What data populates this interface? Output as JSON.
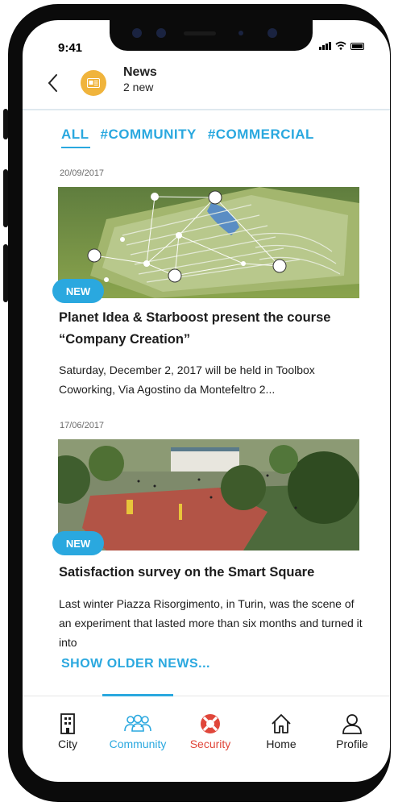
{
  "status": {
    "time": "9:41"
  },
  "header": {
    "title": "News",
    "subtitle": "2 new"
  },
  "tabs": [
    "ALL",
    "#COMMUNITY",
    "#COMMERCIAL"
  ],
  "news": [
    {
      "date": "20/09/2017",
      "badge": "NEW",
      "title": "Planet Idea & Starboost present the course “Company Creation”",
      "body": "Saturday, December 2, 2017 will be held in Toolbox Coworking, Via Agostino da Montefeltro 2..."
    },
    {
      "date": "17/06/2017",
      "badge": "NEW",
      "title": "Satisfaction survey on the Smart Square",
      "body": "Last winter Piazza Risorgimento, in Turin, was the scene of an experiment that lasted more than six months and turned it into"
    }
  ],
  "show_older": "SHOW OLDER NEWS...",
  "bottom_nav": [
    {
      "label": "City",
      "icon": "building-icon",
      "color": "#1c1c1c"
    },
    {
      "label": "Community",
      "icon": "people-icon",
      "color": "#2aa8df"
    },
    {
      "label": "Security",
      "icon": "lifebuoy-icon",
      "color": "#e0463a"
    },
    {
      "label": "Home",
      "icon": "home-icon",
      "color": "#1c1c1c"
    },
    {
      "label": "Profile",
      "icon": "profile-icon",
      "color": "#1c1c1c"
    }
  ],
  "colors": {
    "accent": "#2aa8df",
    "security": "#e0463a",
    "avatar": "#f0b43c"
  }
}
